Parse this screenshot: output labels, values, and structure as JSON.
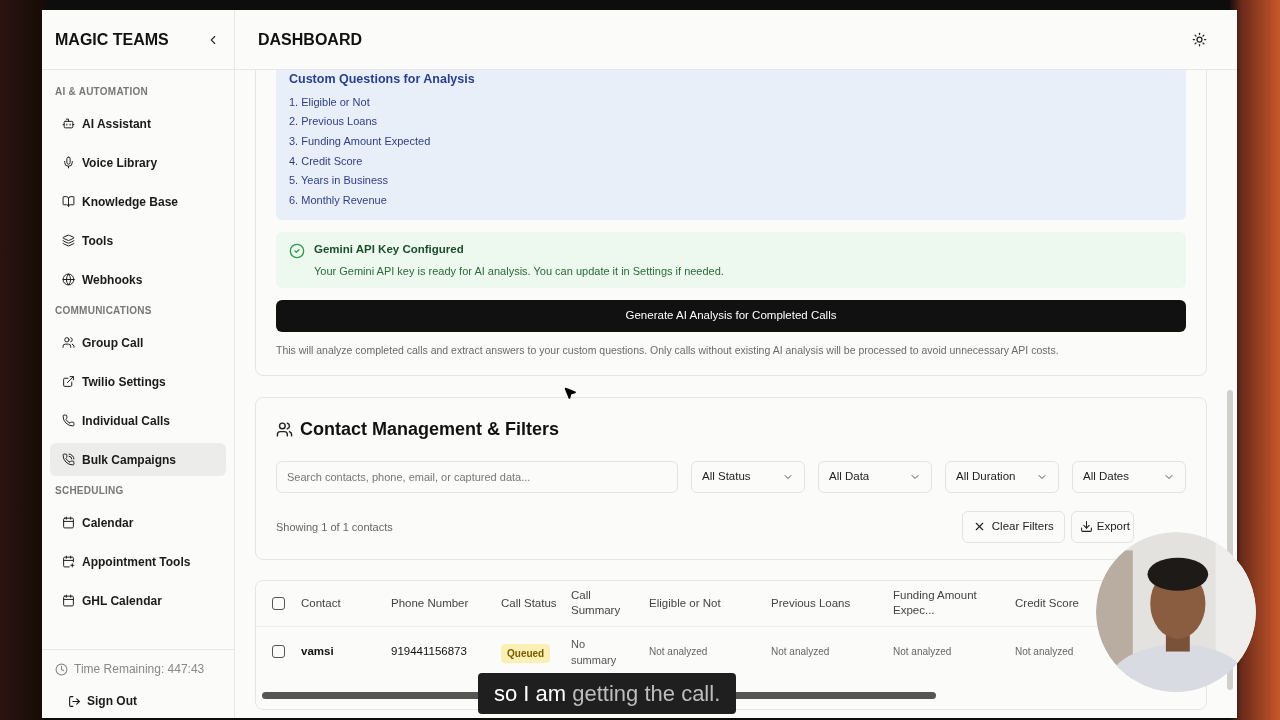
{
  "sidebar": {
    "brand": "MAGIC TEAMS",
    "sections": [
      {
        "title": "AI & AUTOMATION",
        "items": [
          {
            "label": "AI Assistant",
            "selected": false
          },
          {
            "label": "Voice Library",
            "selected": false
          },
          {
            "label": "Knowledge Base",
            "selected": false
          },
          {
            "label": "Tools",
            "selected": false
          },
          {
            "label": "Webhooks",
            "selected": false
          }
        ]
      },
      {
        "title": "COMMUNICATIONS",
        "items": [
          {
            "label": "Group Call",
            "selected": false
          },
          {
            "label": "Twilio Settings",
            "selected": false
          },
          {
            "label": "Individual Calls",
            "selected": false
          },
          {
            "label": "Bulk Campaigns",
            "selected": true
          }
        ]
      },
      {
        "title": "SCHEDULING",
        "items": [
          {
            "label": "Calendar",
            "selected": false
          },
          {
            "label": "Appointment Tools",
            "selected": false
          },
          {
            "label": "GHL Calendar",
            "selected": false
          }
        ]
      }
    ],
    "time_remaining": "Time Remaining: 447:43",
    "sign_out": "Sign Out"
  },
  "header": {
    "title": "DASHBOARD"
  },
  "analysis": {
    "questions_title": "Custom Questions for Analysis",
    "questions": [
      "1. Eligible or Not",
      "2. Previous Loans",
      "3. Funding Amount Expected",
      "4. Credit Score",
      "5. Years in Business",
      "6. Monthly Revenue"
    ],
    "notice": {
      "title": "Gemini API Key Configured",
      "text": "Your Gemini API key is ready for AI analysis. You can update it in Settings if needed."
    },
    "button": "Generate AI Analysis for Completed Calls",
    "note": "This will analyze completed calls and extract answers to your custom questions. Only calls without existing AI analysis will be processed to avoid unnecessary API costs."
  },
  "contacts": {
    "title": "Contact Management & Filters",
    "search": {
      "placeholder": "Search contacts, phone, email, or captured data..."
    },
    "filters": [
      "All Status",
      "All Data",
      "All Duration",
      "All Dates"
    ],
    "showing": "Showing 1 of 1 contacts",
    "clear": "Clear Filters",
    "export": "Export"
  },
  "table": {
    "columns": [
      "Contact",
      "Phone Number",
      "Call Status",
      "Call Summary",
      "Eligible or Not",
      "Previous Loans",
      "Funding Amount Expec...",
      "Credit Score"
    ],
    "rows": [
      {
        "checked": false,
        "cells": [
          "vamsi",
          "919441156873",
          "Queued",
          "No summary",
          "Not analyzed",
          "Not analyzed",
          "Not analyzed",
          "Not analyzed"
        ]
      }
    ],
    "header_checked": false
  },
  "caption": {
    "spoken": "so I am",
    "pending": "getting the call."
  }
}
